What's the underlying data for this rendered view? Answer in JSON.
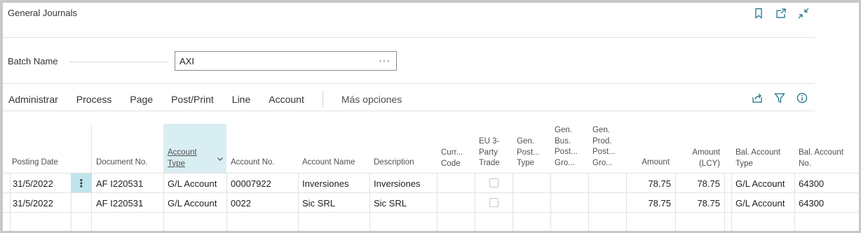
{
  "window": {
    "title": "General Journals"
  },
  "top_icons": [
    "bookmark-icon",
    "open-in-new-window-icon",
    "collapse-icon"
  ],
  "batch": {
    "label": "Batch Name",
    "value": "AXI",
    "lookup": "···"
  },
  "actions": {
    "items": [
      "Administrar",
      "Process",
      "Page",
      "Post/Print",
      "Line",
      "Account"
    ],
    "more": "Más opciones",
    "icons": [
      "share-icon",
      "filter-icon",
      "info-icon"
    ]
  },
  "columns": {
    "posting_date": "Posting Date",
    "document_no": "Document No.",
    "account_type_1": "Account",
    "account_type_2": "Type",
    "account_no": "Account No.",
    "account_name": "Account Name",
    "description": "Description",
    "curr_1": "Curr...",
    "curr_2": "Code",
    "eu_1": "EU 3-",
    "eu_2": "Party",
    "eu_3": "Trade",
    "genpost_1": "Gen.",
    "genpost_2": "Post...",
    "genpost_3": "Type",
    "genbus_1": "Gen.",
    "genbus_2": "Bus.",
    "genbus_3": "Post...",
    "genbus_4": "Gro...",
    "genprod_1": "Gen.",
    "genprod_2": "Prod.",
    "genprod_3": "Post...",
    "genprod_4": "Gro...",
    "amount": "Amount",
    "amount_lcy_1": "Amount",
    "amount_lcy_2": "(LCY)",
    "bal_type_1": "Bal. Account",
    "bal_type_2": "Type",
    "bal_no_1": "Bal. Account",
    "bal_no_2": "No."
  },
  "rows": [
    {
      "posting_date": "31/5/2022",
      "document_no": "AF I220531",
      "account_type": "G/L Account",
      "account_no": "00007922",
      "account_name": "Inversiones",
      "description": "Inversiones",
      "eu_trade": false,
      "amount": "78.75",
      "amount_lcy": "78.75",
      "bal_account_type": "G/L Account",
      "bal_account_no": "64300"
    },
    {
      "posting_date": "31/5/2022",
      "document_no": "AF I220531",
      "account_type": "G/L Account",
      "account_no": "0022",
      "account_name": "Sic SRL",
      "description": "Sic SRL",
      "eu_trade": false,
      "amount": "78.75",
      "amount_lcy": "78.75",
      "bal_account_type": "G/L Account",
      "bal_account_no": "64300"
    }
  ],
  "colors": {
    "selected_header": "#d9eef3",
    "row_menu": "#bfe5ec",
    "accent": "#0f6a83"
  }
}
